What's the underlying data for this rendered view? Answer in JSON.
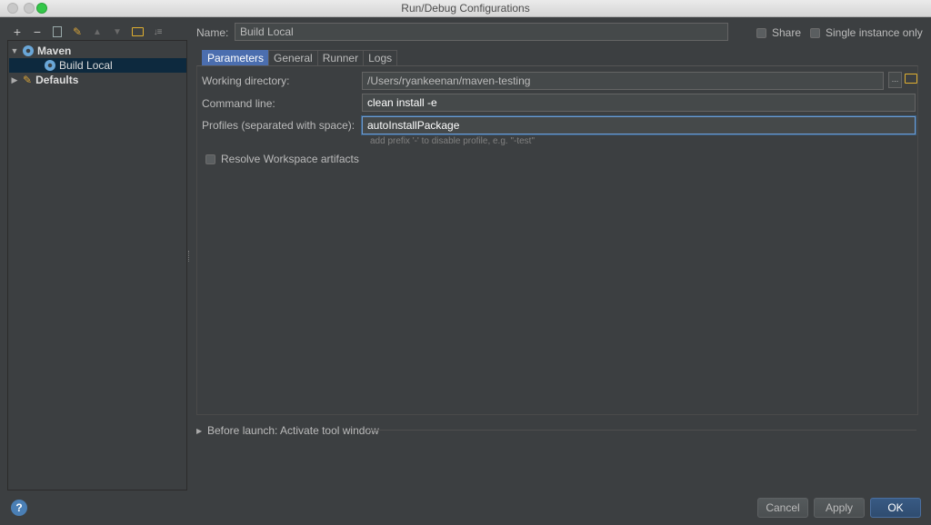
{
  "window": {
    "title": "Run/Debug Configurations"
  },
  "toolbar": {
    "buttons": [
      {
        "name": "add-icon",
        "glyph": "+"
      },
      {
        "name": "remove-icon",
        "glyph": "−"
      },
      {
        "name": "copy-icon",
        "glyph": ""
      },
      {
        "name": "edit-defaults-icon",
        "glyph": ""
      },
      {
        "name": "move-up-icon",
        "glyph": "▲"
      },
      {
        "name": "move-down-icon",
        "glyph": "▼"
      },
      {
        "name": "folder-icon",
        "glyph": ""
      },
      {
        "name": "sort-icon",
        "glyph": ""
      }
    ]
  },
  "tree": {
    "items": [
      {
        "label": "Maven",
        "expanded": true,
        "icon": "maven-gear-icon"
      },
      {
        "label": "Build Local",
        "selected": true,
        "icon": "maven-gear-icon"
      },
      {
        "label": "Defaults",
        "expanded": false,
        "icon": "defaults-icon"
      }
    ]
  },
  "config": {
    "name_label": "Name:",
    "name_value": "Build Local",
    "share_label": "Share",
    "single_instance_label": "Single instance only"
  },
  "tabs": [
    "Parameters",
    "General",
    "Runner",
    "Logs"
  ],
  "params": {
    "working_dir_label": "Working directory:",
    "working_dir_value": "/Users/ryankeenan/maven-testing",
    "command_line_label": "Command line:",
    "command_line_value": "clean install -e",
    "profiles_label": "Profiles (separated with space):",
    "profiles_value": "autoInstallPackage",
    "profiles_hint": "add prefix '-' to disable profile, e.g. \"-test\"",
    "resolve_label": "Resolve Workspace artifacts",
    "browse_label": "..."
  },
  "before_launch": {
    "label": "Before launch: Activate tool window"
  },
  "footer": {
    "help": "?",
    "cancel": "Cancel",
    "apply": "Apply",
    "ok": "OK"
  },
  "colors": {
    "background": "#3c3f41",
    "accent": "#4b6eaf",
    "selection": "#0d293e"
  }
}
